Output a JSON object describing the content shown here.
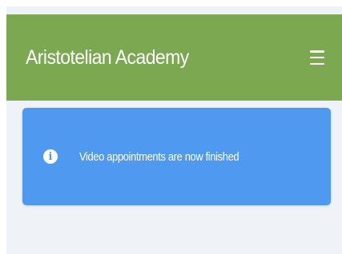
{
  "header": {
    "brand": "Aristotelian Academy",
    "menu_icon": "hamburger-menu-icon",
    "background_color": "#7ba850"
  },
  "alert": {
    "icon": "info-icon",
    "icon_glyph": "i",
    "message": "Video appointments are now finished",
    "background_color": "#4f9af0"
  },
  "page": {
    "background_color": "#eff2f6"
  }
}
